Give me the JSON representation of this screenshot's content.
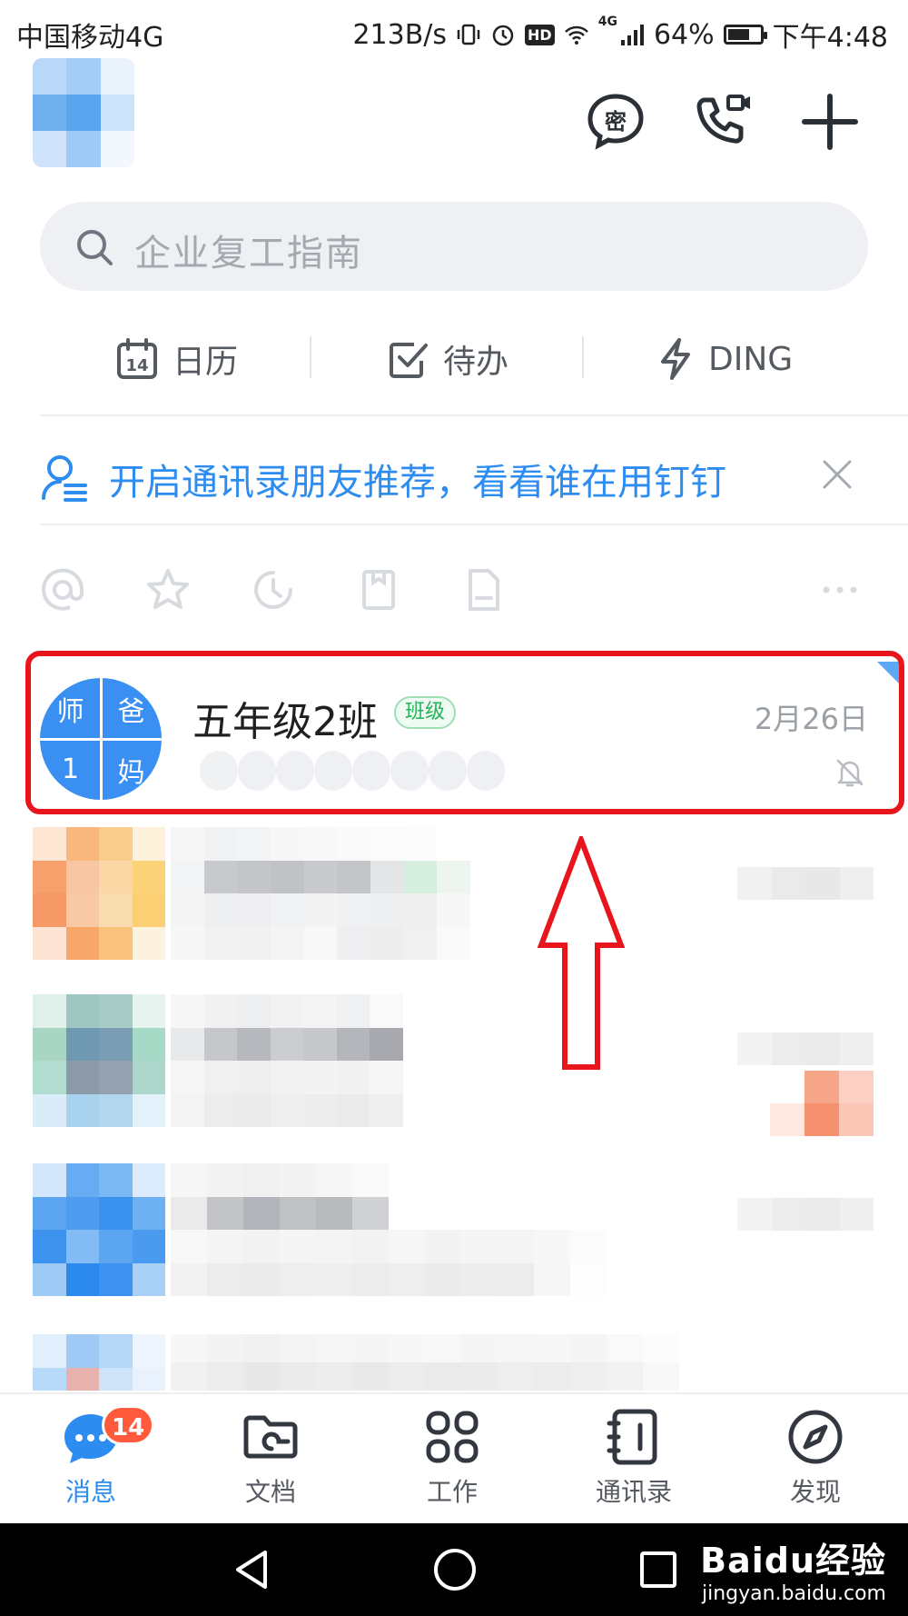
{
  "status_bar": {
    "carrier": "中国移动4G",
    "speed": "213B/s",
    "battery": "64%",
    "battery_level": 0.64,
    "time": "下午4:48",
    "network_badge": "4G",
    "hd_badge": "HD"
  },
  "header": {
    "actions": [
      {
        "name": "secret-chat",
        "icon": "secret-chat-icon",
        "glyph": "密"
      },
      {
        "name": "video-call",
        "icon": "video-call-icon"
      },
      {
        "name": "add",
        "icon": "plus-icon"
      }
    ]
  },
  "search": {
    "placeholder": "企业复工指南"
  },
  "quick_actions": {
    "calendar": {
      "label": "日历",
      "icon": "calendar-icon",
      "day": "14"
    },
    "todo": {
      "label": "待办",
      "icon": "check-square-icon"
    },
    "ding": {
      "label": "DING",
      "icon": "lightning-icon"
    }
  },
  "banner": {
    "text": "开启通讯录朋友推荐，看看谁在用钉钉",
    "icon": "contact-recommend-icon"
  },
  "filters": [
    "at-icon",
    "star-icon",
    "clock-icon",
    "bookmark-icon",
    "file-icon",
    "more-icon"
  ],
  "highlighted_chat": {
    "name": "五年级2班",
    "tag": "班级",
    "time": "2月26日",
    "avatar_cells": [
      "师",
      "爸",
      "1",
      "妈"
    ],
    "muted": true
  },
  "tabs": [
    {
      "label": "消息",
      "icon": "message-icon",
      "active": true,
      "badge": "14"
    },
    {
      "label": "文档",
      "icon": "folder-icon",
      "active": false
    },
    {
      "label": "工作",
      "icon": "grid-icon",
      "active": false
    },
    {
      "label": "通讯录",
      "icon": "contacts-icon",
      "active": false
    },
    {
      "label": "发现",
      "icon": "compass-icon",
      "active": false
    }
  ],
  "watermark": {
    "main": "Baidu经验",
    "sub": "jingyan.baidu.com"
  },
  "colors": {
    "accent": "#2d8cf0",
    "highlight_red": "#e8151c",
    "badge": "#ff5a3c",
    "tag_green": "#25b45a"
  }
}
